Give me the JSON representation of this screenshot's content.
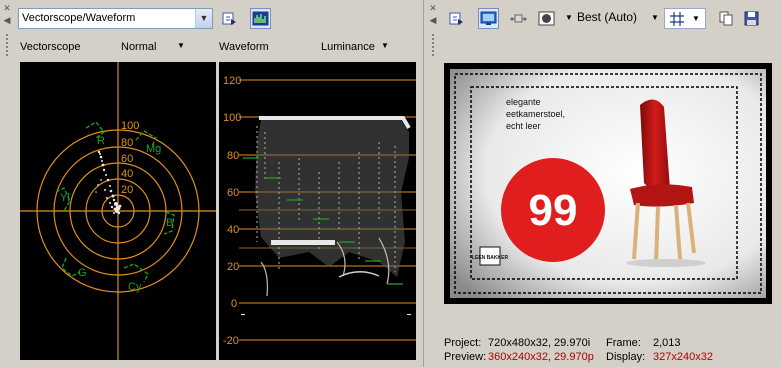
{
  "left_panel": {
    "scope_selector": {
      "value": "Vectorscope/Waveform"
    },
    "vectorscope": {
      "title": "Vectorscope",
      "mode": "Normal",
      "ring_labels": [
        "100",
        "80",
        "60",
        "40",
        "20"
      ],
      "target_labels": [
        "Mg",
        "R",
        "Yl",
        "B",
        "G",
        "Cy"
      ]
    },
    "waveform": {
      "title": "Waveform",
      "mode": "Luminance",
      "y_ticks": [
        "120",
        "100",
        "80",
        "60",
        "40",
        "20",
        "0",
        "-20"
      ]
    }
  },
  "right_panel": {
    "quality": "Best (Auto)",
    "status": {
      "project_label": "Project:",
      "project_value": "720x480x32, 29.970i",
      "frame_label": "Frame:",
      "frame_value": "2,013",
      "preview_label": "Preview:",
      "preview_value": "360x240x32, 29.970p",
      "display_label": "Display:",
      "display_value": "327x240x32"
    },
    "frame_content": {
      "caption_line1": "elegante",
      "caption_line2": "eetkamerstoel,",
      "caption_line3": "echt leer",
      "price": "99",
      "logo_text": "LEEN BAKKER"
    }
  },
  "colors": {
    "graticule": "#e0901c",
    "target": "#1fa01f",
    "trace": "#e8e8e8",
    "accent_red": "#b00000"
  }
}
